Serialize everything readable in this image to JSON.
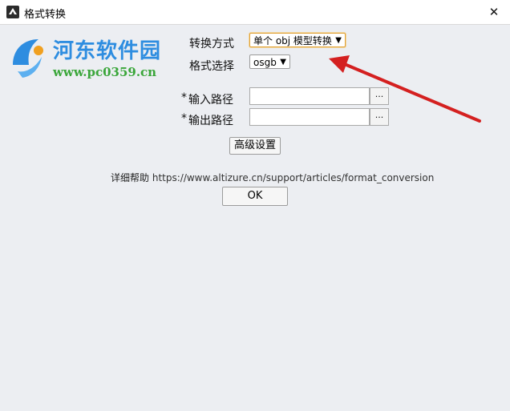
{
  "window": {
    "title": "格式转换",
    "close_glyph": "✕"
  },
  "watermark": {
    "site_name": "河东软件园",
    "site_url": "www.pc0359.cn"
  },
  "form": {
    "mode_label": "转换方式",
    "mode_value": "单个 obj 模型转换",
    "format_label": "格式选择",
    "format_value": "osgb",
    "dropdown_glyph": "▼",
    "required_mark": "*",
    "input_path_label": "输入路径",
    "input_path_value": "",
    "output_path_label": "输出路径",
    "output_path_value": "",
    "browse_label": "...",
    "advanced_label": "高级设置"
  },
  "help": {
    "prefix": "详细帮助",
    "url": "https://www.altizure.cn/support/articles/format_conversion"
  },
  "ok_label": "OK",
  "colors": {
    "annotation_arrow": "#d42020",
    "background": "#eceef2",
    "focus_border": "#e0a33b"
  }
}
